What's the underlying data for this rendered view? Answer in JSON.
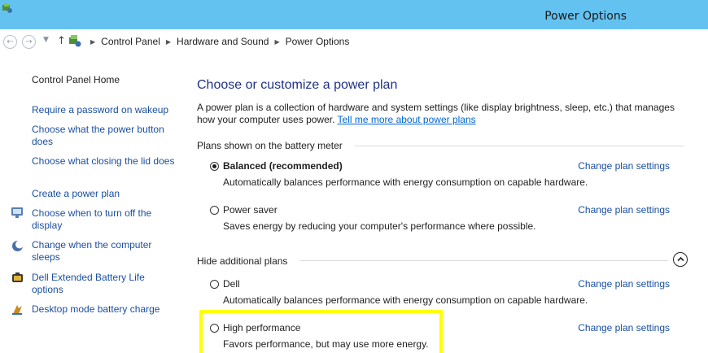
{
  "window": {
    "title": "Power Options"
  },
  "address": {
    "crumbs": [
      "Control Panel",
      "Hardware and Sound",
      "Power Options"
    ]
  },
  "sidebar": {
    "home": "Control Panel Home",
    "links": [
      "Require a password on wakeup",
      "Choose what the power button does",
      "Choose what closing the lid does",
      "Create a power plan",
      "Choose when to turn off the display",
      "Change when the computer sleeps",
      "Dell Extended Battery Life options",
      "Desktop mode battery charge"
    ]
  },
  "main": {
    "title": "Choose or customize a power plan",
    "description": "A power plan is a collection of hardware and system settings (like display brightness, sleep, etc.) that manages how your computer uses power.",
    "learn_more": "Tell me more about power plans",
    "section_battery": "Plans shown on the battery meter",
    "section_hide": "Hide additional plans",
    "change_link": "Change plan settings",
    "plans": [
      {
        "name": "Balanced (recommended)",
        "desc": "Automatically balances performance with energy consumption on capable hardware.",
        "selected": true
      },
      {
        "name": "Power saver",
        "desc": "Saves energy by reducing your computer's performance where possible.",
        "selected": false
      },
      {
        "name": "Dell",
        "desc": "Automatically balances performance with energy consumption on capable hardware.",
        "selected": false
      },
      {
        "name": "High performance",
        "desc": "Favors performance, but may use more energy.",
        "selected": false
      }
    ]
  },
  "colors": {
    "titlebar": "#64c2f0",
    "link": "#1a4fa0",
    "heading": "#1e3287",
    "highlight": "#ffff00"
  },
  "icons": [
    "power-options-icon",
    "back-arrow-icon",
    "forward-arrow-icon",
    "chevron-down-icon",
    "up-arrow-icon",
    "breadcrumb-separator-icon",
    "display-icon",
    "moon-icon",
    "battery-icon",
    "desktop-battery-icon",
    "chevron-up-icon"
  ]
}
